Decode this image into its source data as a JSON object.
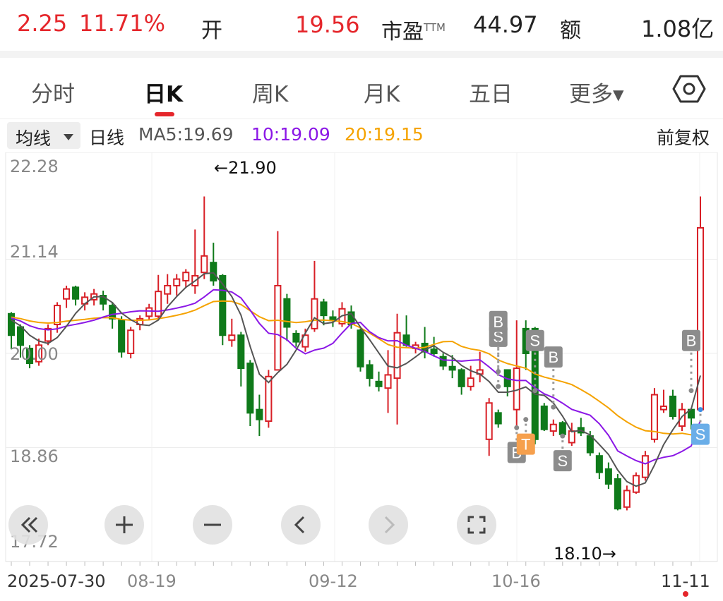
{
  "quote": {
    "change_amount": "2.25",
    "change_percent": "11.71%",
    "open_label": "开",
    "open_value": "19.56",
    "pe_label": "市盈",
    "pe_sup": "TTM",
    "pe_value": "44.97",
    "amount_label": "额",
    "amount_value": "1.08亿"
  },
  "tabs": [
    {
      "label": "分时"
    },
    {
      "label": "日K"
    },
    {
      "label": "周K"
    },
    {
      "label": "月K"
    },
    {
      "label": "五日"
    },
    {
      "label": "更多▾"
    }
  ],
  "ma": {
    "select_label": "均线",
    "period_label": "日线",
    "ma5": "MA5:19.69",
    "ma10": "10:19.09",
    "ma20": "20:19.15",
    "adjust": "前复权",
    "colors": {
      "ma5": "#555555",
      "ma10": "#8b17e6",
      "ma20": "#f5a300"
    }
  },
  "chart_data": {
    "type": "candlestick",
    "y_tick_labels": [
      "22.28",
      "21.14",
      "20.00",
      "18.86",
      "17.72"
    ],
    "ylim": [
      17.72,
      22.28
    ],
    "x_tick_labels": [
      "2025-07-30",
      "08-19",
      "09-12",
      "10-16",
      "11-11"
    ],
    "high_annotation": "←21.90",
    "low_annotation": "18.10→",
    "up_color": "#d81f26",
    "down_color": "#0f7a1a",
    "candles": [
      [
        20.48,
        20.22,
        20.5,
        20.05
      ],
      [
        20.32,
        20.1,
        20.35,
        19.95
      ],
      [
        20.06,
        19.88,
        20.1,
        19.82
      ],
      [
        19.9,
        20.1,
        20.18,
        19.85
      ],
      [
        20.15,
        20.3,
        20.35,
        20.1
      ],
      [
        20.35,
        20.58,
        20.62,
        20.25
      ],
      [
        20.66,
        20.78,
        20.82,
        20.55
      ],
      [
        20.8,
        20.66,
        20.82,
        20.58
      ],
      [
        20.6,
        20.68,
        20.74,
        20.52
      ],
      [
        20.65,
        20.72,
        20.78,
        20.58
      ],
      [
        20.7,
        20.6,
        20.76,
        20.52
      ],
      [
        20.58,
        20.42,
        20.62,
        20.3
      ],
      [
        20.4,
        20.02,
        20.45,
        19.95
      ],
      [
        20.0,
        20.28,
        20.32,
        19.94
      ],
      [
        20.35,
        20.42,
        20.46,
        20.28
      ],
      [
        20.45,
        20.55,
        20.6,
        20.4
      ],
      [
        20.45,
        20.75,
        20.95,
        20.4
      ],
      [
        20.72,
        20.82,
        20.96,
        20.6
      ],
      [
        20.82,
        20.9,
        20.96,
        20.7
      ],
      [
        20.88,
        20.98,
        21.02,
        20.8
      ],
      [
        20.82,
        20.94,
        21.5,
        20.72
      ],
      [
        20.98,
        21.18,
        21.9,
        20.9
      ],
      [
        21.1,
        20.88,
        21.34,
        20.82
      ],
      [
        20.94,
        20.22,
        20.96,
        20.1
      ],
      [
        20.16,
        20.22,
        20.42,
        20.08
      ],
      [
        20.22,
        19.82,
        20.26,
        19.6
      ],
      [
        19.88,
        19.28,
        19.92,
        19.12
      ],
      [
        19.32,
        19.2,
        19.5,
        19.0
      ],
      [
        19.18,
        19.72,
        19.8,
        19.1
      ],
      [
        19.8,
        20.82,
        21.48,
        19.8
      ],
      [
        20.66,
        20.32,
        20.72,
        20.15
      ],
      [
        20.24,
        20.14,
        20.28,
        20.08
      ],
      [
        20.08,
        20.22,
        20.3,
        20.02
      ],
      [
        20.3,
        20.66,
        21.12,
        20.26
      ],
      [
        20.62,
        20.46,
        20.66,
        20.34
      ],
      [
        20.44,
        20.4,
        20.52,
        20.32
      ],
      [
        20.36,
        20.54,
        20.62,
        20.32
      ],
      [
        20.5,
        20.35,
        20.58,
        20.3
      ],
      [
        20.28,
        19.84,
        20.3,
        19.78
      ],
      [
        19.86,
        19.7,
        19.92,
        19.6
      ],
      [
        19.66,
        19.6,
        19.78,
        19.54
      ],
      [
        19.58,
        19.74,
        20.04,
        19.28
      ],
      [
        19.7,
        20.25,
        20.48,
        19.14
      ],
      [
        20.22,
        20.1,
        20.46,
        20.08
      ],
      [
        20.06,
        20.1,
        20.14,
        20.0
      ],
      [
        20.12,
        20.02,
        20.32,
        19.94
      ],
      [
        20.05,
        20.0,
        20.2,
        19.96
      ],
      [
        19.96,
        19.85,
        20.0,
        19.8
      ],
      [
        19.84,
        19.8,
        19.98,
        19.7
      ],
      [
        19.8,
        19.6,
        19.82,
        19.5
      ],
      [
        19.6,
        19.7,
        19.85,
        19.55
      ],
      [
        19.75,
        19.8,
        20.02,
        19.65
      ],
      [
        18.96,
        19.4,
        19.46,
        18.76
      ],
      [
        19.28,
        19.15,
        19.32,
        19.1
      ],
      [
        19.8,
        19.6,
        19.8,
        19.48
      ],
      [
        19.32,
        19.82,
        20.4,
        19.08
      ],
      [
        20.3,
        20.0,
        20.4,
        19.8
      ],
      [
        20.3,
        18.96,
        20.32,
        18.9
      ],
      [
        19.36,
        19.08,
        19.4,
        19.06
      ],
      [
        19.06,
        19.14,
        19.2,
        19.0
      ],
      [
        19.16,
        19.02,
        19.18,
        18.98
      ],
      [
        18.92,
        19.06,
        19.16,
        18.88
      ],
      [
        19.1,
        19.04,
        19.22,
        19.0
      ],
      [
        19.0,
        18.8,
        19.06,
        18.76
      ],
      [
        18.76,
        18.56,
        18.8,
        18.48
      ],
      [
        18.6,
        18.42,
        18.68,
        18.36
      ],
      [
        18.48,
        18.12,
        18.54,
        18.1
      ],
      [
        18.14,
        18.34,
        18.4,
        18.1
      ],
      [
        18.32,
        18.52,
        18.56,
        18.3
      ],
      [
        18.5,
        18.76,
        18.82,
        18.46
      ],
      [
        18.96,
        19.5,
        19.58,
        18.92
      ],
      [
        19.32,
        19.36,
        19.56,
        19.28
      ],
      [
        19.48,
        19.24,
        19.56,
        19.2
      ],
      [
        19.12,
        19.32,
        19.4,
        19.06
      ],
      [
        19.32,
        19.22,
        19.3,
        19.08
      ],
      [
        19.32,
        21.52,
        21.9,
        19.3
      ]
    ]
  },
  "trade_markers": {
    "buy_label": "B",
    "sell_label": "S",
    "t_label": "T"
  },
  "controls": {
    "rewind": "rewind-button",
    "zoom_in": "zoom-in-button",
    "zoom_out": "zoom-out-button",
    "prev": "prev-button",
    "next": "next-button",
    "fullscreen": "fullscreen-button"
  }
}
